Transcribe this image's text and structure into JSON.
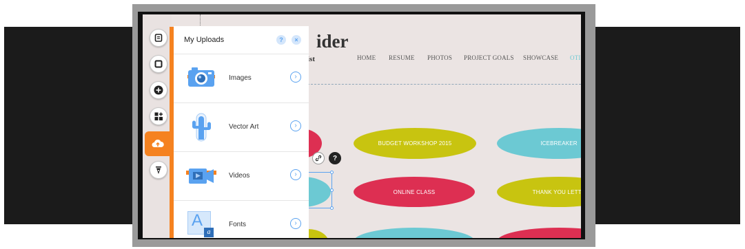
{
  "panel": {
    "title": "My Uploads",
    "help_label": "?",
    "close_label": "×",
    "items": [
      {
        "label": "Images",
        "icon": "camera-icon"
      },
      {
        "label": "Vector Art",
        "icon": "cactus-icon"
      },
      {
        "label": "Videos",
        "icon": "video-camera-icon"
      },
      {
        "label": "Fonts",
        "icon": "font-icon"
      }
    ],
    "font_icon_big": "A",
    "font_icon_small": "a",
    "arrow_glyph": "›"
  },
  "toolbar": {
    "buttons": [
      "pages-icon",
      "background-icon",
      "add-icon",
      "app-market-icon",
      "upload-icon",
      "blog-pen-icon"
    ]
  },
  "site": {
    "title_fragment": "ider",
    "subtitle_fragment": "ist",
    "nav": [
      "HOME",
      "RESUME",
      "PHOTOS",
      "PROJECT GOALS",
      "SHOWCASE",
      "OTI"
    ]
  },
  "ovals": {
    "budget": "BUDGET WORKSHOP 2015",
    "icebreaker": "ICEBREAKER",
    "online": "ONLINE CLASS",
    "thankyou": "THANK YOU LETTE"
  },
  "colors": {
    "accent_orange": "#f58220",
    "yellow": "#c8c410",
    "red": "#dd2f52",
    "cyan": "#6cc9d3",
    "link_blue": "#5aa2f0"
  }
}
